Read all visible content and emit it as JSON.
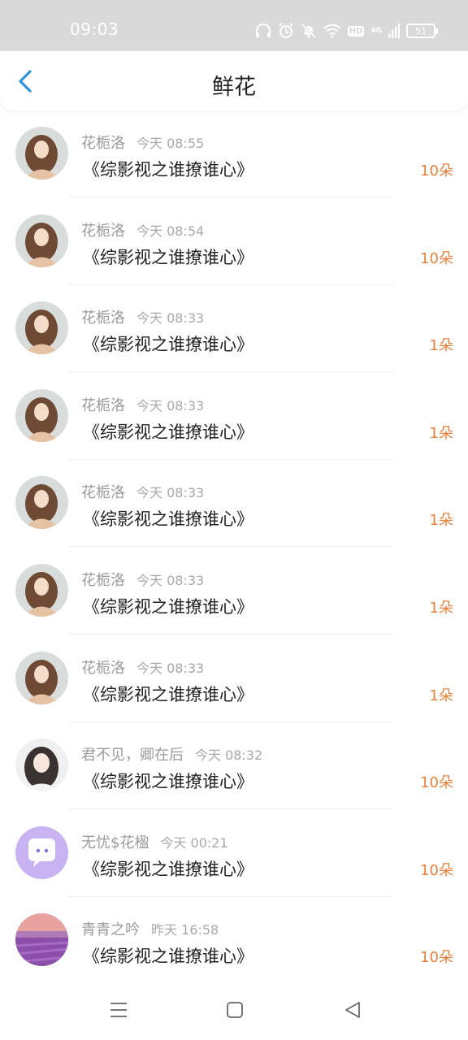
{
  "status_bar": {
    "time": "09:03",
    "battery": "51",
    "network": "4G",
    "hd": "HD"
  },
  "nav": {
    "title": "鲜花"
  },
  "items": [
    {
      "name": "花栀洛",
      "time": "今天 08:55",
      "book": "《综影视之谁撩谁心》",
      "count": "10朵",
      "avatar": "woman-photo"
    },
    {
      "name": "花栀洛",
      "time": "今天 08:54",
      "book": "《综影视之谁撩谁心》",
      "count": "10朵",
      "avatar": "woman-photo"
    },
    {
      "name": "花栀洛",
      "time": "今天 08:33",
      "book": "《综影视之谁撩谁心》",
      "count": "1朵",
      "avatar": "woman-photo"
    },
    {
      "name": "花栀洛",
      "time": "今天 08:33",
      "book": "《综影视之谁撩谁心》",
      "count": "1朵",
      "avatar": "woman-photo"
    },
    {
      "name": "花栀洛",
      "time": "今天 08:33",
      "book": "《综影视之谁撩谁心》",
      "count": "1朵",
      "avatar": "woman-photo"
    },
    {
      "name": "花栀洛",
      "time": "今天 08:33",
      "book": "《综影视之谁撩谁心》",
      "count": "1朵",
      "avatar": "woman-photo"
    },
    {
      "name": "花栀洛",
      "time": "今天 08:33",
      "book": "《综影视之谁撩谁心》",
      "count": "1朵",
      "avatar": "woman-photo"
    },
    {
      "name": "君不见，卿在后",
      "time": "今天 08:32",
      "book": "《综影视之谁撩谁心》",
      "count": "10朵",
      "avatar": "woman-photo-light"
    },
    {
      "name": "无忧$花楹",
      "time": "今天 00:21",
      "book": "《综影视之谁撩谁心》",
      "count": "10朵",
      "avatar": "chat-bubble-icon"
    },
    {
      "name": "青青之吟",
      "time": "昨天 16:58",
      "book": "《综影视之谁撩谁心》",
      "count": "10朵",
      "avatar": "lavender-field"
    }
  ],
  "colors": {
    "accent_blue": "#2f93e0",
    "count_orange": "#e8803a",
    "status_bar_gray": "#d9d9d9"
  }
}
